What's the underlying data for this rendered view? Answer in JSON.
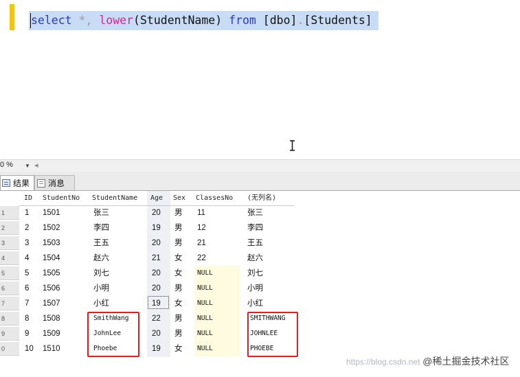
{
  "editor": {
    "tokens": {
      "select": "select",
      "star": "*,",
      "lower": "lower",
      "arg": "(StudentName)",
      "from": "from",
      "schema": "[dbo]",
      "dot": ".",
      "table": "[Students]"
    }
  },
  "zoom": {
    "value": "0 %"
  },
  "tabs": {
    "results": "结果",
    "messages": "消息"
  },
  "grid": {
    "columns": [
      "ID",
      "StudentNo",
      "StudentName",
      "Age",
      "Sex",
      "ClassesNo",
      "(无列名)"
    ],
    "row_numbers": [
      "1",
      "2",
      "3",
      "4",
      "5",
      "6",
      "7",
      "8",
      "9",
      "0"
    ],
    "rows": [
      [
        "1",
        "1501",
        "张三",
        "20",
        "男",
        "11",
        "张三"
      ],
      [
        "2",
        "1502",
        "李四",
        "19",
        "男",
        "12",
        "李四"
      ],
      [
        "3",
        "1503",
        "王五",
        "20",
        "男",
        "21",
        "王五"
      ],
      [
        "4",
        "1504",
        "赵六",
        "21",
        "女",
        "22",
        "赵六"
      ],
      [
        "5",
        "1505",
        "刘七",
        "20",
        "女",
        "NULL",
        "刘七"
      ],
      [
        "6",
        "1506",
        "小明",
        "20",
        "男",
        "NULL",
        "小明"
      ],
      [
        "7",
        "1507",
        "小红",
        "19",
        "女",
        "NULL",
        "小红"
      ],
      [
        "8",
        "1508",
        "SmithWang",
        "22",
        "男",
        "NULL",
        "SMITHWANG"
      ],
      [
        "9",
        "1509",
        "JohnLee",
        "20",
        "男",
        "NULL",
        "JOHNLEE"
      ],
      [
        "10",
        "1510",
        "Phoebe",
        "19",
        "女",
        "NULL",
        "PHOEBE"
      ]
    ]
  },
  "watermark": {
    "url": "https://blog.csdn.net",
    "brand": "@稀土掘金技术社区"
  },
  "colors": {
    "selection": "#c8dcf5",
    "keyword": "#2b37c8",
    "function": "#d0288f",
    "highlight_box": "#e02020",
    "null_cell": "#fffbe1"
  }
}
